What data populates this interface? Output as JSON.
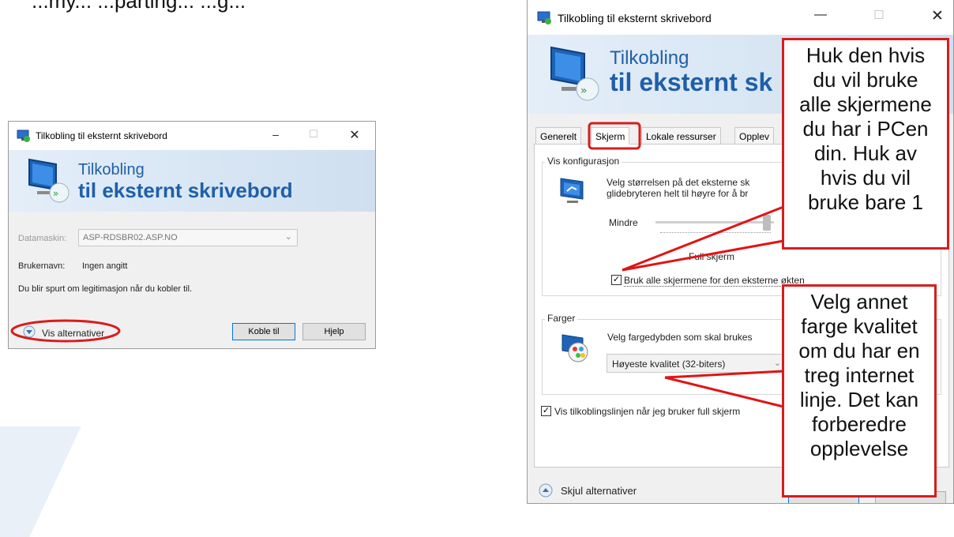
{
  "top_text": "...my... ...parting... ...g...",
  "small_window": {
    "title": "Tilkobling til eksternt skrivebord",
    "controls": {
      "minimize": "–",
      "maximize": "☐",
      "close": "✕"
    },
    "banner": {
      "line1": "Tilkobling",
      "line2": "til eksternt skrivebord"
    },
    "computer_label": "Datamaskin:",
    "computer_value": "ASP-RDSBR02.ASP.NO",
    "username_label": "Brukernavn:",
    "username_value": "Ingen angitt",
    "info_text": "Du blir spurt om legitimasjon når du kobler til.",
    "show_options": "Vis alternativer",
    "connect_button": "Koble til",
    "help_button": "Hjelp"
  },
  "large_window": {
    "title": "Tilkobling til eksternt skrivebord",
    "controls": {
      "minimize": "—",
      "maximize": "☐",
      "close": "✕"
    },
    "banner": {
      "line1": "Tilkobling",
      "line2": "til eksternt sk"
    },
    "tabs": [
      {
        "label": "Generelt"
      },
      {
        "label": "Skjerm"
      },
      {
        "label": "Lokale ressurser"
      },
      {
        "label": "Opplev"
      }
    ],
    "display_group": {
      "title": "Vis konfigurasjon",
      "line1": "Velg størrelsen på det eksterne sk",
      "line2": "glidebryteren helt til høyre for å br",
      "slider_min_label": "Mindre",
      "slider_value_label": "Full skjerm",
      "all_monitors_checkbox": "Bruk alle skjermene for den eksterne økten",
      "all_monitors_checked": true
    },
    "colors_group": {
      "title": "Farger",
      "description": "Velg fargedybden som skal brukes",
      "selected_quality": "Høyeste kvalitet (32-biters)"
    },
    "connection_bar_checkbox": "Vis tilkoblingslinjen når jeg bruker full skjerm",
    "connection_bar_checked": true,
    "hide_options": "Skjul alternativer"
  },
  "callouts": {
    "monitors": [
      "Huk den hvis",
      "du vil bruke",
      "alle skjermene",
      "du har i PCen",
      "din. Huk av",
      "hvis du vil",
      "bruke bare 1"
    ],
    "colors": [
      "Velg annet",
      "farge kvalitet",
      "om du har en",
      "treg internet",
      "linje. Det kan",
      "forberedre",
      "opplevelse"
    ]
  },
  "colors": {
    "accent_red": "#d81c1c",
    "title_blue": "#1f5fa8",
    "banner_bg": "#dbe7f4"
  }
}
